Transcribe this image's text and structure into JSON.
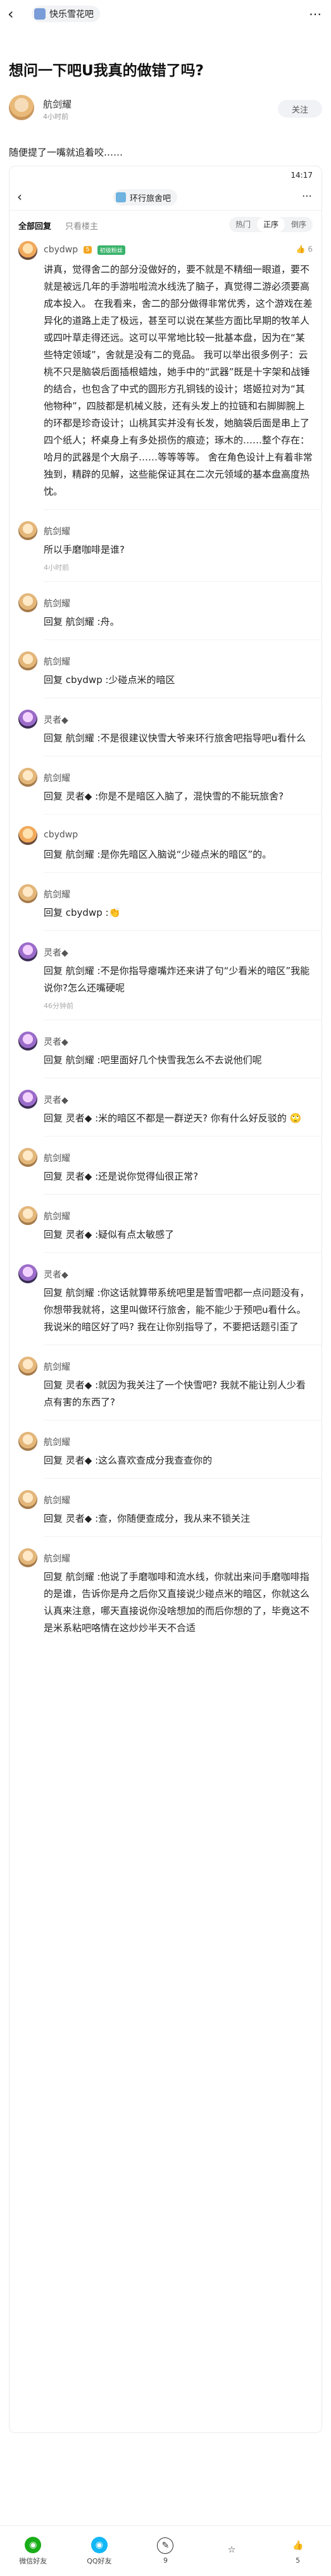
{
  "app": {
    "forum_name": "快乐雪花吧",
    "more_glyph": "⋯"
  },
  "post": {
    "title": "想问一下吧U我真的做错了吗?",
    "author": "航剑耀",
    "time": "4小时前",
    "follow_label": "关注",
    "body": "随便提了一嘴就追着咬……"
  },
  "screenshot": {
    "status_time": "14:17",
    "inner_forum": "环行旅舍吧",
    "filter_all": "全部回复",
    "filter_host": "只看楼主",
    "sort_options": [
      "热门",
      "正序",
      "倒序"
    ],
    "sort_selected": "正序",
    "op": {
      "name": "cbydwp",
      "badge_lv": "5",
      "badge_rel": "初级粉丝",
      "likes": "6",
      "text": "讲真，觉得舍二的部分没做好的，要不就是不精细一眼道，要不就是被远几年的手游啦啦流水线洗了脑子，真觉得二游必须要高成本投入。 在我看来，舍二的部分做得非常优秀，这个游戏在差异化的道路上走了极远，甚至可以说在某些方面比早期的牧羊人或四叶草走得还远。这可以平常地比较一批基本盘，因为在“某些特定领域”，舍就是没有二的竞品。 我可以举出很多例子：云桃不只是脑袋后面插根蜡烛，她手中的“武器”既是十字架和战锤的结合，也包含了中式的圆形方孔铜钱的设计；塔姬拉对为“其他物种”，四肢都是机械义肢，还有头发上的拉链和右脚脚腕上的环都是珍奇设计；山桃其实并没有长发，她脑袋后面是串上了四个纸人；杯桌身上有多处损伤的痕迹；琢木的……整个存在：哈月的武器是个大扇子……等等等等。 舍在角色设计上有着非常独到，精辟的见解，这些能保证其在二次元领域的基本盘高度热忱。"
    },
    "replies": [
      {
        "name": "航剑耀",
        "text": "所以手磨咖啡是谁?",
        "meta": "4小时前",
        "subs": [
          {
            "name": "航剑耀",
            "text": "回复 航剑耀 :舟。"
          },
          {
            "name": "航剑耀",
            "text": "回复 cbydwp :少碰点米的暗区"
          }
        ]
      },
      {
        "name": "灵者◆",
        "text": "回复 航剑耀 :不是很建议快雪大爷来环行旅舍吧指导吧u看什么",
        "meta": "",
        "subs": [
          {
            "name": "航剑耀",
            "text": "回复 灵者◆ :你是不是暗区入脑了，混快雪的不能玩旅舍?"
          },
          {
            "name": "cbydwp",
            "text": "回复 航剑耀 :是你先暗区入脑说“少碰点米的暗区”的。"
          },
          {
            "name": "航剑耀",
            "text": "回复 cbydwp :👏"
          }
        ]
      },
      {
        "name": "灵者◆",
        "text": "回复 航剑耀 :不是你指导瘪嘴炸还来讲了句“少看米的暗区”我能说你?怎么还嘴硬呢",
        "meta": "46分钟前",
        "subs": [
          {
            "name": "灵者◆",
            "text": "回复 航剑耀 :吧里面好几个快雪我怎么不去说他们呢"
          },
          {
            "name": "灵者◆",
            "text": "回复 灵者◆ :米的暗区不都是一群逆天? 你有什么好反驳的 🙄"
          },
          {
            "name": "航剑耀",
            "text": "回复 灵者◆ :还是说你觉得仙很正常?"
          },
          {
            "name": "航剑耀",
            "text": "回复 灵者◆ :疑似有点太敏感了"
          }
        ]
      },
      {
        "name": "灵者◆",
        "text": "回复 航剑耀 :你这话就算带系统吧里是暂雪吧都一点问题没有，你想带我就将，这里叫做环行旅舍，能不能少于预吧u看什么。我说米的暗区好了吗? 我在让你别指导了，不要把话题引歪了",
        "meta": "",
        "subs": [
          {
            "name": "航剑耀",
            "text": "回复 灵者◆ :就因为我关注了一个快雪吧? 我就不能让别人少看点有害的东西了?"
          },
          {
            "name": "航剑耀",
            "text": "回复 灵者◆ :这么喜欢查成分我查查你的"
          },
          {
            "name": "航剑耀",
            "text": "回复 灵者◆ :查，你随便查成分，我从来不锁关注"
          },
          {
            "name": "航剑耀",
            "text": "回复 航剑耀 :他说了手磨咖啡和流水线，你就出来问手磨咖啡指的是谁，告诉你是舟之后你又直接说少碰点米的暗区，你就这么认真来注意，哪天直接说你没啥想加的而后你想的了，毕竟这不是米系粘吧咯情在这炒炒半天不合适"
          }
        ]
      }
    ]
  },
  "dock": {
    "items": [
      {
        "label": "微信好友",
        "icon": "wechat-icon",
        "glyph": "◉"
      },
      {
        "label": "QQ好友",
        "icon": "qq-icon",
        "glyph": "◉"
      },
      {
        "label": "9",
        "icon": "comment-icon",
        "glyph": "✎"
      },
      {
        "label": "",
        "icon": "star-icon",
        "glyph": "☆"
      },
      {
        "label": "5",
        "icon": "like-icon",
        "glyph": "👍"
      }
    ]
  }
}
